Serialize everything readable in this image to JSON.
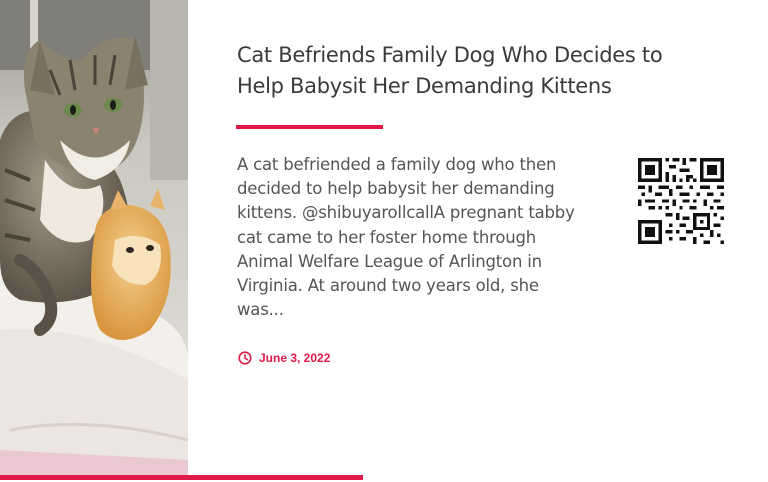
{
  "article": {
    "title": "Cat Befriends Family Dog Who Decides to Help Babysit Her Demanding Kittens",
    "excerpt": "A cat befriended a family dog who then decided to help babysit her demanding kittens. @shibuyarollcallA pregnant tabby cat came to her foster home through Animal Welfare League of Arlington in Virginia. At around two years old, she was...",
    "date": "June 3, 2022",
    "image_subject": "tabby-cat-with-orange-kitten",
    "qr_code": "qr-code-icon",
    "date_icon": "clock-icon"
  },
  "colors": {
    "accent": "#e01a48",
    "title_text": "#3a3a3a",
    "body_text": "#555555",
    "background": "#ffffff"
  }
}
